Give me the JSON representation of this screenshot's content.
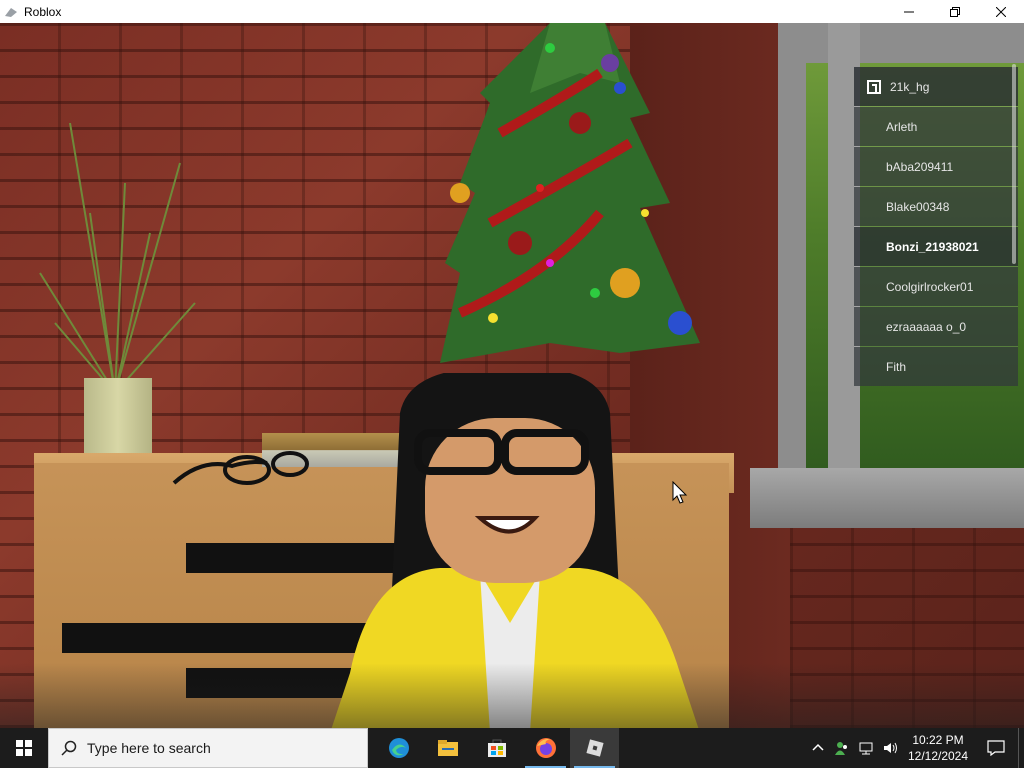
{
  "window": {
    "title": "Roblox",
    "controls": [
      "minimize-icon",
      "maximize-icon",
      "close-icon"
    ]
  },
  "playerlist": {
    "header": "21k_hg",
    "players": [
      {
        "name": "Arleth",
        "selected": false
      },
      {
        "name": "bAba209411",
        "selected": false
      },
      {
        "name": "Blake00348",
        "selected": false
      },
      {
        "name": "Bonzi_21938021",
        "selected": true
      },
      {
        "name": "Coolgirlrocker01",
        "selected": false
      },
      {
        "name": "ezraaaaaa o_0",
        "selected": false
      },
      {
        "name": "Fith",
        "selected": false
      }
    ]
  },
  "taskbar": {
    "search_placeholder": "Type here to search",
    "apps": [
      {
        "name": "edge-icon",
        "running": false
      },
      {
        "name": "file-explorer-icon",
        "running": false
      },
      {
        "name": "store-icon",
        "running": false
      },
      {
        "name": "firefox-icon",
        "running": true
      },
      {
        "name": "roblox-icon",
        "running": true,
        "active": true
      }
    ],
    "tray_icons": [
      "chevron-up-icon",
      "people-icon",
      "network-icon",
      "volume-icon"
    ],
    "time": "10:22 PM",
    "date": "12/12/2024"
  },
  "colors": {
    "taskbar_bg": "#1c1c1c",
    "playerlist_bg": "rgba(50,55,60,0.72)",
    "running_indicator": "#76b9ed"
  }
}
